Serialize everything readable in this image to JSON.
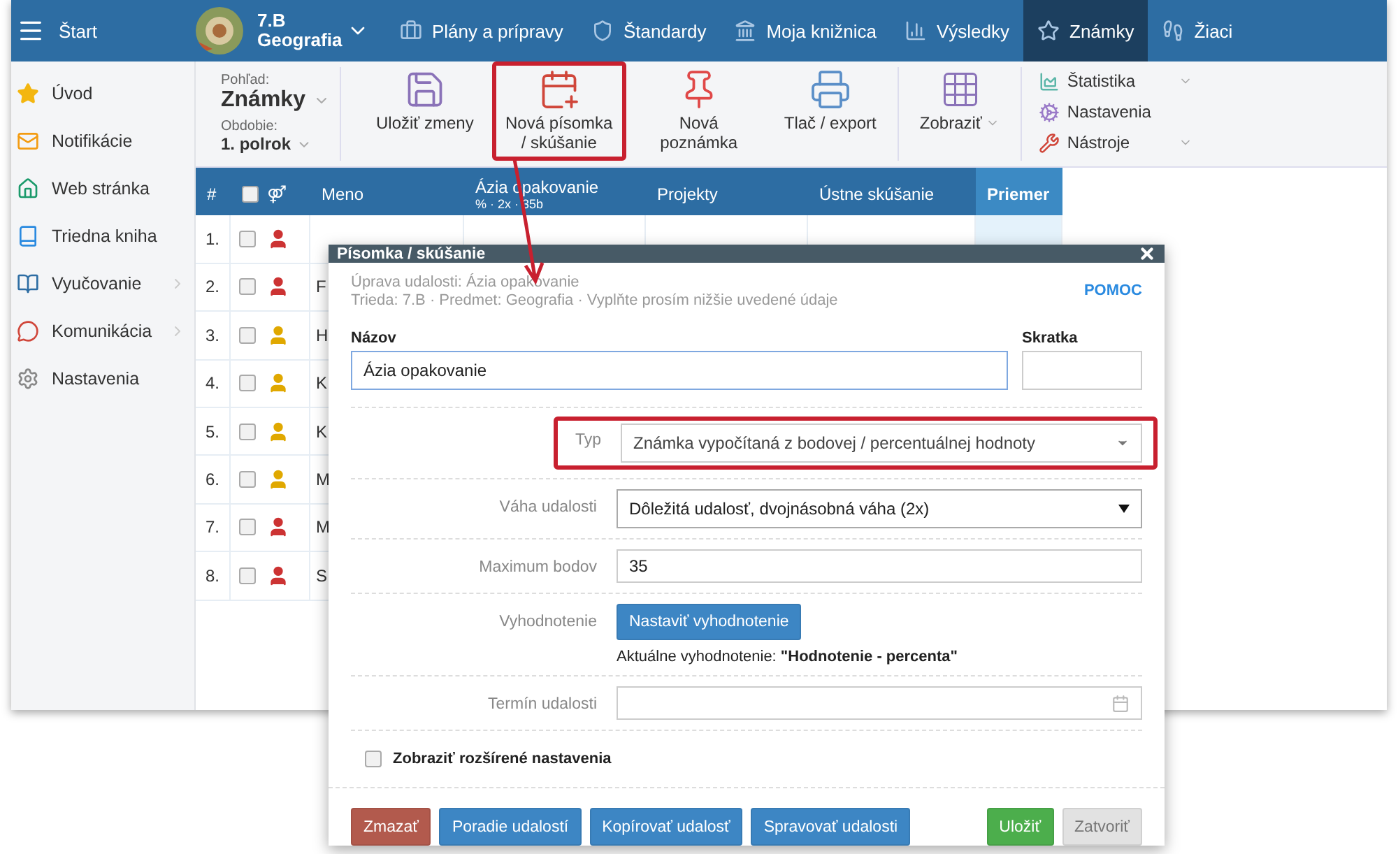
{
  "topbar": {
    "start": "Štart",
    "class_name": "7.B",
    "subject": "Geografia",
    "nav": [
      {
        "label": "Plány a prípravy",
        "selected": false
      },
      {
        "label": "Štandardy",
        "selected": false
      },
      {
        "label": "Moja knižnica",
        "selected": false
      },
      {
        "label": "Výsledky",
        "selected": false
      },
      {
        "label": "Známky",
        "selected": true
      },
      {
        "label": "Žiaci",
        "selected": false
      }
    ]
  },
  "sidebar": {
    "items": [
      {
        "label": "Úvod",
        "expandable": false
      },
      {
        "label": "Notifikácie",
        "expandable": false
      },
      {
        "label": "Web stránka",
        "expandable": false
      },
      {
        "label": "Triedna kniha",
        "expandable": false
      },
      {
        "label": "Vyučovanie",
        "expandable": true
      },
      {
        "label": "Komunikácia",
        "expandable": true
      },
      {
        "label": "Nastavenia",
        "expandable": false
      }
    ]
  },
  "toolbar": {
    "view_label": "Pohľad:",
    "view_value": "Známky",
    "period_label": "Obdobie:",
    "period_value": "1. polrok",
    "buttons": [
      {
        "label": "Uložiť zmeny",
        "highlighted": false
      },
      {
        "label": "Nová písomka / skúšanie",
        "highlighted": true
      },
      {
        "label": "Nová poznámka",
        "highlighted": false
      },
      {
        "label": "Tlač / export",
        "highlighted": false
      }
    ],
    "display": "Zobraziť",
    "menu": [
      {
        "label": "Štatistika",
        "dropdown": true
      },
      {
        "label": "Nastavenia",
        "dropdown": false
      },
      {
        "label": "Nástroje",
        "dropdown": true
      }
    ]
  },
  "table": {
    "columns": [
      "#",
      "⚤",
      "Meno",
      "Ázia opakovanie",
      "Projekty",
      "Ústne skúšanie",
      "Priemer"
    ],
    "column_sub": "% · 2x · 35b",
    "select_all_checked": false,
    "rows": [
      {
        "number": "1.",
        "kind": "male",
        "checked": false
      },
      {
        "number": "2.",
        "kind": "male",
        "checked": false,
        "name": "F"
      },
      {
        "number": "3.",
        "kind": "female",
        "checked": false,
        "name": "H"
      },
      {
        "number": "4.",
        "kind": "female",
        "checked": false,
        "name": "K"
      },
      {
        "number": "5.",
        "kind": "female",
        "checked": false,
        "name": "K"
      },
      {
        "number": "6.",
        "kind": "female",
        "checked": false,
        "name": "M"
      },
      {
        "number": "7.",
        "kind": "male",
        "checked": false,
        "name": "M"
      },
      {
        "number": "8.",
        "kind": "male",
        "checked": false,
        "name": "S"
      }
    ]
  },
  "dialog": {
    "title": "Písomka / skúšanie",
    "help": "POMOC",
    "subtitle": "Úprava udalosti: Ázia opakovanie",
    "info": "Trieda: 7.B · Predmet: Geografia · Vyplňte prosím nižšie uvedené údaje",
    "name_label": "Názov",
    "name_value": "Ázia opakovanie",
    "abbrev_label": "Skratka",
    "type_label": "Typ",
    "type_value": "Známka vypočítaná z bodovej / percentuálnej hodnoty",
    "type_highlighted": true,
    "weight_label": "Váha udalosti",
    "weight_value": "Dôležitá udalosť, dvojnásobná váha (2x)",
    "max_label": "Maximum bodov",
    "max_value": "35",
    "eval_label": "Vyhodnotenie",
    "eval_button": "Nastaviť vyhodnotenie",
    "eval_current": "Aktuálne vyhodnotenie: **\"Hodnotenie - percenta\"**",
    "term_label": "Termín udalosti",
    "advanced": {
      "label": "Zobraziť rozšírené nastavenia",
      "checked": false
    },
    "buttons": [
      {
        "label": "Zmazať",
        "kind": "danger"
      },
      {
        "label": "Poradie udalostí",
        "kind": "primary"
      },
      {
        "label": "Kopírovať udalosť",
        "kind": "primary"
      },
      {
        "label": "Spravovať udalosti",
        "kind": "primary"
      },
      {
        "label": "Uložiť",
        "kind": "success"
      },
      {
        "label": "Zatvoriť",
        "kind": "default"
      }
    ]
  }
}
